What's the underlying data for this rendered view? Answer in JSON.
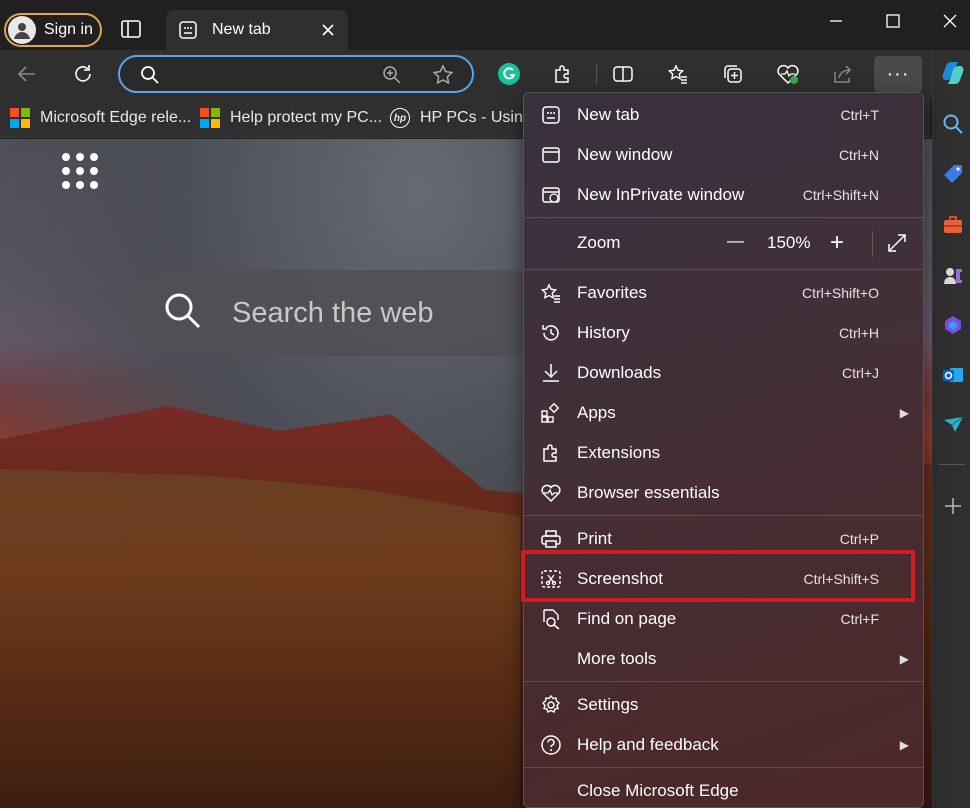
{
  "window": {
    "signin_label": "Sign in",
    "tab_title": "New tab"
  },
  "favorites_bar": [
    {
      "label": "Microsoft Edge rele...",
      "icon": "microsoft-logo-icon"
    },
    {
      "label": "Help protect my PC...",
      "icon": "microsoft-logo-icon"
    },
    {
      "label": "HP PCs - Using",
      "icon": "hp-logo-icon"
    }
  ],
  "content": {
    "search_placeholder": "Search the web"
  },
  "menu": {
    "items": [
      {
        "label": "New tab",
        "shortcut": "Ctrl+T",
        "icon": "new-tab-icon"
      },
      {
        "label": "New window",
        "shortcut": "Ctrl+N",
        "icon": "new-window-icon"
      },
      {
        "label": "New InPrivate window",
        "shortcut": "Ctrl+Shift+N",
        "icon": "inprivate-icon"
      },
      {
        "label": "Favorites",
        "shortcut": "Ctrl+Shift+O",
        "icon": "favorites-icon"
      },
      {
        "label": "History",
        "shortcut": "Ctrl+H",
        "icon": "history-icon"
      },
      {
        "label": "Downloads",
        "shortcut": "Ctrl+J",
        "icon": "download-icon"
      },
      {
        "label": "Apps",
        "shortcut": "",
        "icon": "apps-icon"
      },
      {
        "label": "Extensions",
        "shortcut": "",
        "icon": "extensions-icon"
      },
      {
        "label": "Browser essentials",
        "shortcut": "",
        "icon": "heartbeat-icon"
      },
      {
        "label": "Print",
        "shortcut": "Ctrl+P",
        "icon": "print-icon"
      },
      {
        "label": "Screenshot",
        "shortcut": "Ctrl+Shift+S",
        "icon": "screenshot-icon"
      },
      {
        "label": "Find on page",
        "shortcut": "Ctrl+F",
        "icon": "find-icon"
      },
      {
        "label": "More tools",
        "shortcut": "",
        "icon": ""
      },
      {
        "label": "Settings",
        "shortcut": "",
        "icon": "gear-icon"
      },
      {
        "label": "Help and feedback",
        "shortcut": "",
        "icon": "help-icon"
      },
      {
        "label": "Close Microsoft Edge",
        "shortcut": "",
        "icon": ""
      }
    ],
    "zoom": {
      "label": "Zoom",
      "value": "150%",
      "minus": "—",
      "plus": "+"
    }
  },
  "colors": {
    "highlight": "#d21c24",
    "address_focus": "#5aa6e6",
    "signin_ring": "#e0a64a"
  }
}
